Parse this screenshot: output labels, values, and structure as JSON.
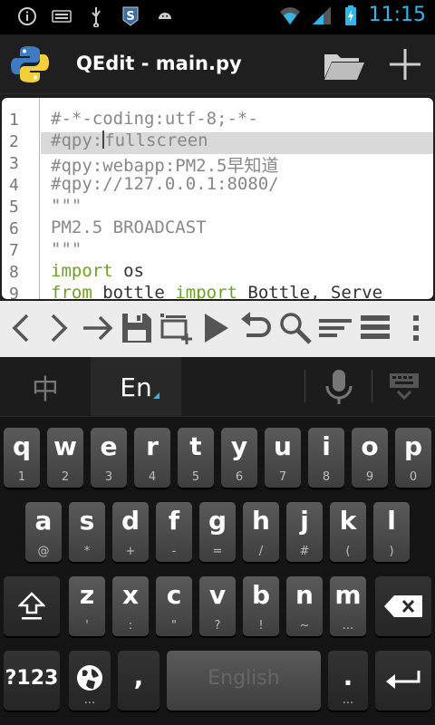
{
  "status": {
    "time": "11:15"
  },
  "app": {
    "title": "QEdit - main.py"
  },
  "editor": {
    "line_numbers": [
      "1",
      "2",
      "3",
      "4",
      "5",
      "6",
      "7",
      "8",
      "9"
    ],
    "lines": [
      "#-*-coding:utf-8;-*-",
      "fullscreen",
      "#qpy:webapp:PM2.5早知道",
      "#qpy://127.0.0.1:8080/",
      "\"\"\"",
      "PM2.5 BROADCAST",
      "\"\"\"",
      "os",
      "bottle"
    ],
    "line2_prefix": "#qpy:",
    "line8_kw": "import",
    "line9_kw1": "from",
    "line9_kw2": "import",
    "line9_tail": "Bottle, Serve",
    "current_line": 2
  },
  "toolbar": {
    "icons": [
      "back-icon",
      "forward-icon",
      "goto-icon",
      "save-icon",
      "snippet-add-icon",
      "run-icon",
      "undo-icon",
      "search-icon",
      "indent-icon",
      "list-icon",
      "overflow-menu-icon"
    ]
  },
  "keyboard": {
    "lang_zh": "中",
    "lang_en": "En",
    "row1": [
      {
        "m": "q",
        "s": "1"
      },
      {
        "m": "w",
        "s": "2"
      },
      {
        "m": "e",
        "s": "3"
      },
      {
        "m": "r",
        "s": "4"
      },
      {
        "m": "t",
        "s": "5"
      },
      {
        "m": "y",
        "s": "6"
      },
      {
        "m": "u",
        "s": "7"
      },
      {
        "m": "i",
        "s": "8"
      },
      {
        "m": "o",
        "s": "9"
      },
      {
        "m": "p",
        "s": "0"
      }
    ],
    "row2": [
      {
        "m": "a",
        "s": "@"
      },
      {
        "m": "s",
        "s": "*"
      },
      {
        "m": "d",
        "s": "+"
      },
      {
        "m": "f",
        "s": "-"
      },
      {
        "m": "g",
        "s": "="
      },
      {
        "m": "h",
        "s": "/"
      },
      {
        "m": "j",
        "s": "#"
      },
      {
        "m": "k",
        "s": "("
      },
      {
        "m": "l",
        "s": ")"
      }
    ],
    "row3": [
      {
        "m": "z",
        "s": "'"
      },
      {
        "m": "x",
        "s": ":"
      },
      {
        "m": "c",
        "s": "\""
      },
      {
        "m": "v",
        "s": "?"
      },
      {
        "m": "b",
        "s": "!"
      },
      {
        "m": "n",
        "s": "~"
      },
      {
        "m": "m",
        "s": "..."
      }
    ],
    "symbols_label": "?123",
    "comma": ",",
    "space_label": "English",
    "period": ".",
    "ellipsis": "..."
  },
  "colors": {
    "accent": "#33b5e5",
    "keyword": "#6ea31e"
  }
}
